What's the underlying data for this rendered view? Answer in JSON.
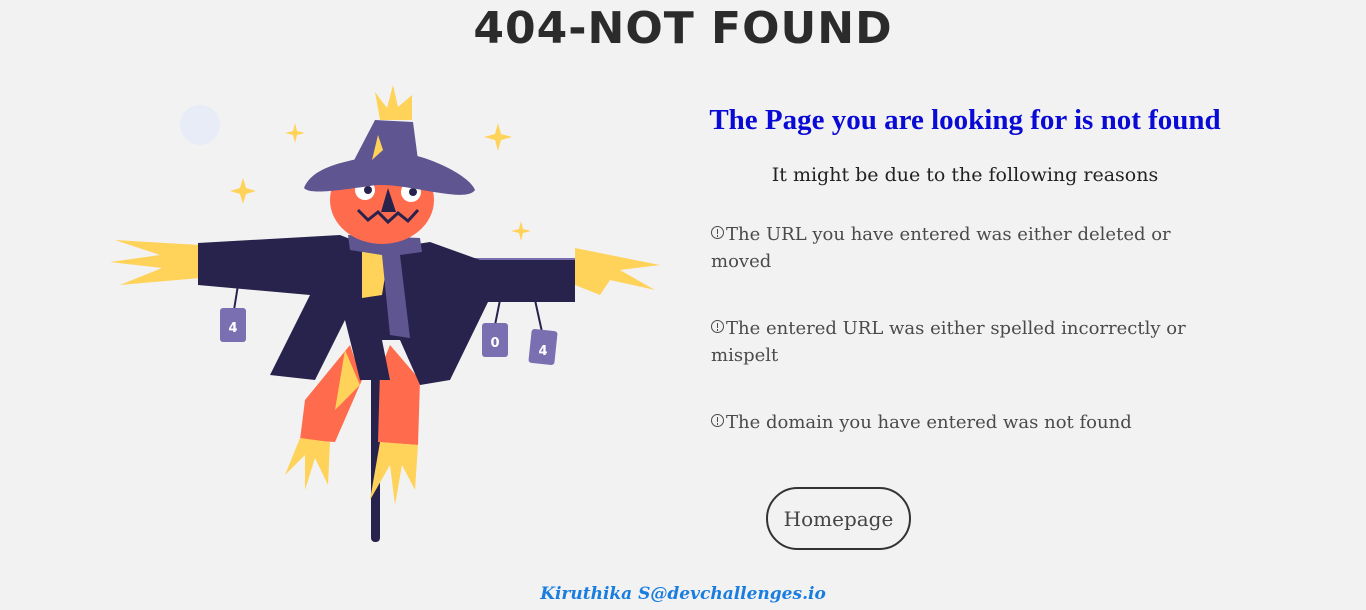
{
  "header": {
    "title": "404-NOT FOUND"
  },
  "main": {
    "subtitle": "The Page you are looking for is not found",
    "reasons_heading": "It might be due to the following reasons",
    "reasons": [
      "The URL you have entered was either deleted or moved",
      "The entered URL was either spelled incorrectly or mispelt",
      "The domain you have entered was not found"
    ],
    "reason_icon": "alert-circle-icon",
    "homepage_button": "Homepage"
  },
  "illustration": {
    "cans": [
      "4",
      "0",
      "4"
    ]
  },
  "footer": {
    "credit": "Kiruthika S@devchallenges.io"
  },
  "colors": {
    "background": "#f2f2f2",
    "subtitle": "#0a0ad6",
    "footer_link": "#1a7de0",
    "hat": "#5f5590",
    "coat": "#28234d",
    "face": "#ff6b4d",
    "straw": "#ffd25a"
  }
}
